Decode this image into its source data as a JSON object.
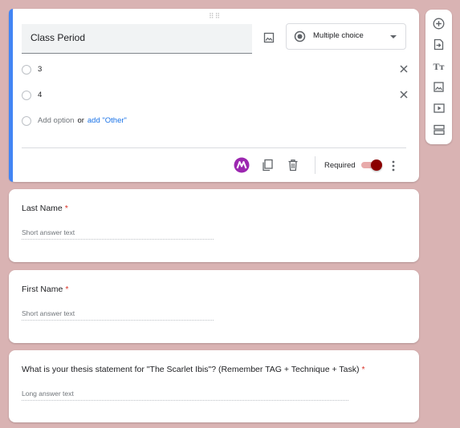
{
  "active_question": {
    "title": "Class Period",
    "type_select": {
      "selected": "Multiple choice",
      "icon": "radio-button-icon"
    },
    "options": [
      {
        "label": "3"
      },
      {
        "label": "4"
      }
    ],
    "add_option": {
      "label": "Add option",
      "or": "or",
      "other_link": "add \"Other\""
    },
    "footer": {
      "required_label": "Required",
      "required_on": true,
      "accent_color": "#8b0000",
      "addon_color": "#9c27b0"
    }
  },
  "questions": [
    {
      "title": "Last Name",
      "required_mark": "*",
      "placeholder": "Short answer text"
    },
    {
      "title": "First Name",
      "required_mark": "*",
      "placeholder": "Short answer text"
    },
    {
      "title": "What is your thesis statement for \"The Scarlet Ibis\"? (Remember TAG + Technique + Task)",
      "required_mark": "*",
      "placeholder": "Long answer text"
    }
  ],
  "toolbar": {
    "items": [
      "add-question-icon",
      "import-questions-icon",
      "add-title-icon",
      "add-image-icon",
      "add-video-icon",
      "add-section-icon"
    ],
    "title_glyph": "Tт"
  },
  "colors": {
    "background": "#d9b3b3",
    "accent": "#4285f4",
    "required": "#d93025",
    "link": "#1a73e8"
  }
}
